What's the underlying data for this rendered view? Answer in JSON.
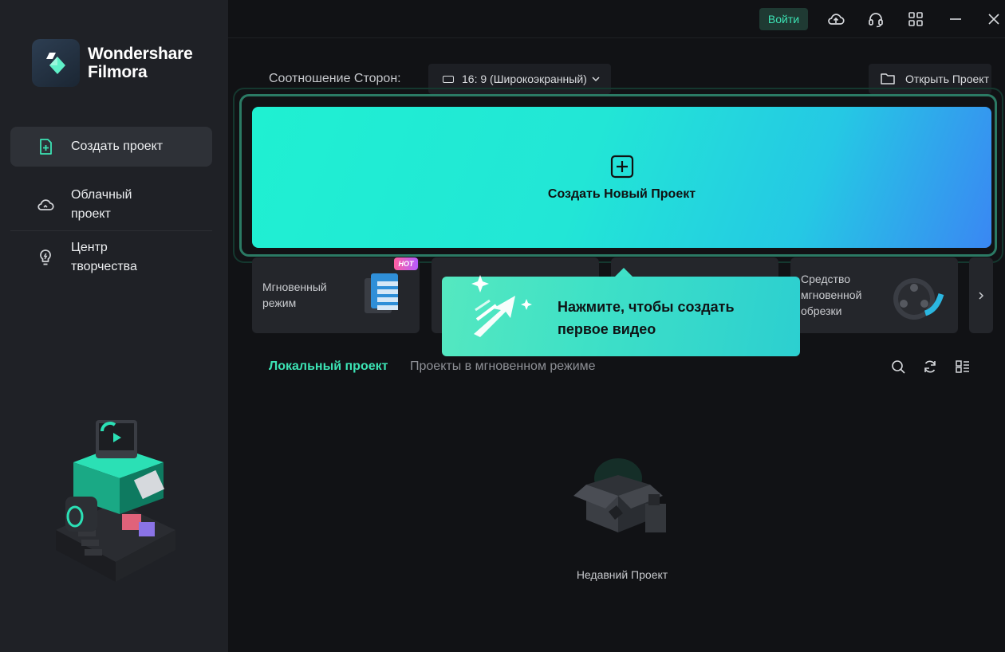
{
  "app": {
    "name": "Wondershare Filmora",
    "name_line1": "Wondershare",
    "name_line2": "Filmora"
  },
  "sidebar": {
    "items": [
      {
        "label": "Создать проект",
        "icon": "new-project-icon",
        "active": true
      },
      {
        "label_line1": "Облачный",
        "label_line2": "проект",
        "icon": "cloud-icon",
        "active": false
      },
      {
        "label_line1": "Центр",
        "label_line2": "творчества",
        "icon": "lightbulb-icon",
        "active": false
      }
    ]
  },
  "topbar": {
    "login_label": "Войти",
    "icons": [
      "cloud-upload-icon",
      "headset-icon",
      "grid-icon",
      "minimize-icon",
      "close-icon"
    ]
  },
  "aspect": {
    "label": "Соотношение Сторон:",
    "value": "16: 9 (Широкоэкранный)"
  },
  "open_project": {
    "label": "Открыть Проект"
  },
  "create": {
    "label": "Создать Новый Проект",
    "icon": "plus-square-icon"
  },
  "features": [
    {
      "line1": "Мгновенный",
      "line2": "режим",
      "badge": "HOT"
    },
    {
      "line1": "",
      "line2": ""
    },
    {
      "line1": "",
      "line2": ""
    },
    {
      "line1": "Средство",
      "line2": "мгновенной",
      "line3": "обрезки"
    }
  ],
  "tooltip": {
    "line1": "Нажмите, чтобы создать",
    "line2": "первое видео"
  },
  "tabs": {
    "local": "Локальный проект",
    "instant": "Проекты в мгновенном режиме"
  },
  "empty": {
    "label": "Недавний Проект"
  },
  "colors": {
    "accent": "#3ce3b4",
    "sidebar_bg": "#1f2126",
    "main_bg": "#111215",
    "card_bg": "#24262b"
  }
}
